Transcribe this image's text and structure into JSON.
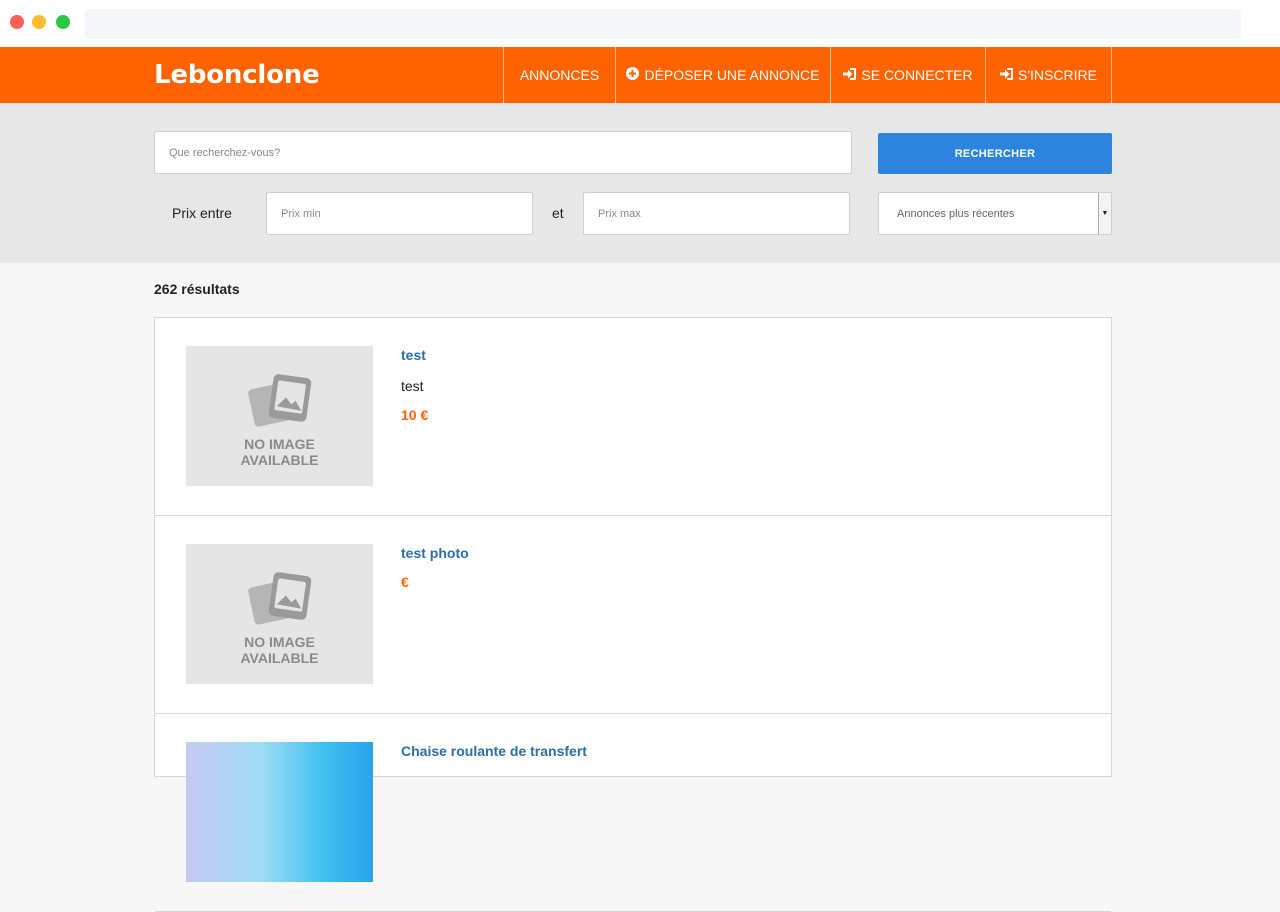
{
  "header": {
    "logo": "Lebonclone",
    "nav": [
      {
        "label": "ANNONCES",
        "icon": ""
      },
      {
        "label": "DÉPOSER UNE ANNONCE",
        "icon": "plus-circle-icon"
      },
      {
        "label": "SE CONNECTER",
        "icon": "sign-in-icon"
      },
      {
        "label": "S'INSCRIRE",
        "icon": "sign-in-icon"
      }
    ]
  },
  "search": {
    "query_placeholder": "Que recherchez-vous?",
    "button_label": "RECHERCHER",
    "price_label": "Prix entre",
    "price_min_placeholder": "Prix min",
    "and_label": "et",
    "price_max_placeholder": "Prix max",
    "sort_selected": "Annonces plus récentes"
  },
  "results": {
    "count_text": "262 résultats",
    "items": [
      {
        "title": "test",
        "description": "test",
        "price": "10 €",
        "image": "no-image",
        "no_image_text": [
          "NO IMAGE",
          "AVAILABLE"
        ]
      },
      {
        "title": "test photo",
        "description": "",
        "price": "€",
        "image": "no-image",
        "no_image_text": [
          "NO IMAGE",
          "AVAILABLE"
        ]
      },
      {
        "title": "Chaise roulante de transfert",
        "description": "",
        "price": "",
        "image": "photo"
      }
    ]
  },
  "colors": {
    "brand": "#ff6201",
    "button": "#2d84df",
    "link": "#2a6fa8"
  }
}
